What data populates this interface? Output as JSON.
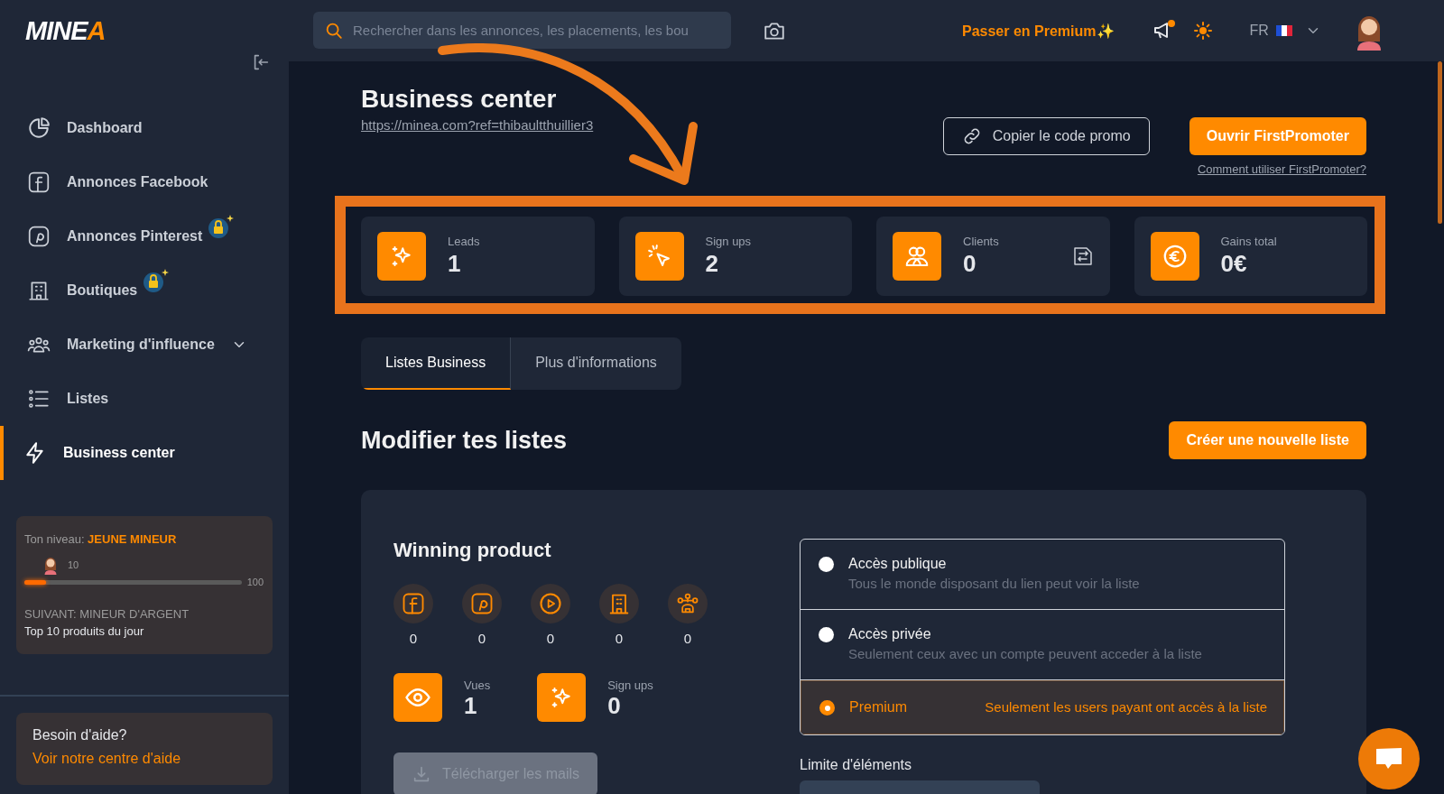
{
  "header": {
    "logo": "MINEA",
    "search": {
      "placeholder": "Rechercher dans les annonces, les placements, les bou"
    },
    "premium_link": "Passer en Premium✨",
    "announcements": {
      "unread": true
    },
    "language": "FR"
  },
  "sidebar": {
    "items": [
      {
        "label": "Dashboard",
        "selected": false,
        "locked": false,
        "expandable": false
      },
      {
        "label": "Annonces Facebook",
        "selected": false,
        "locked": false,
        "expandable": false
      },
      {
        "label": "Annonces Pinterest",
        "selected": false,
        "locked": true,
        "expandable": false
      },
      {
        "label": "Boutiques",
        "selected": false,
        "locked": true,
        "expandable": false
      },
      {
        "label": "Marketing d'influence",
        "selected": false,
        "locked": false,
        "expandable": true
      },
      {
        "label": "Listes",
        "selected": false,
        "locked": false,
        "expandable": false
      },
      {
        "label": "Business center",
        "selected": true,
        "locked": false,
        "expandable": false
      }
    ],
    "level_card": {
      "label": "Ton niveau:",
      "level_name": "JEUNE MINEUR",
      "points": "10",
      "max": "100",
      "level": 0.1,
      "next": "SUIVANT: MINEUR D'ARGENT",
      "reward": "Top 10 produits du jour"
    },
    "help": {
      "title": "Besoin d'aide?",
      "link": "Voir notre centre d'aide"
    }
  },
  "page": {
    "title": "Business center",
    "referral_link": "https://minea.com?ref=thibaultthuillier3",
    "copy_button": "Copier le code promo",
    "open_button": "Ouvrir FirstPromoter",
    "help_link": "Comment utiliser FirstPromoter?"
  },
  "stats": [
    {
      "label": "Leads",
      "value": "1",
      "switchable": false
    },
    {
      "label": "Sign ups",
      "value": "2",
      "switchable": false
    },
    {
      "label": "Clients",
      "value": "0",
      "switchable": true
    },
    {
      "label": "Gains total",
      "value": "0€",
      "switchable": false
    }
  ],
  "tabs": [
    {
      "label": "Listes Business",
      "selected": true
    },
    {
      "label": "Plus d'informations",
      "selected": false
    }
  ],
  "section": {
    "title": "Modifier tes listes",
    "create_button": "Créer une nouvelle liste"
  },
  "list_card": {
    "name": "Winning product",
    "source_counts": [
      "0",
      "0",
      "0",
      "0",
      "0"
    ],
    "metrics": [
      {
        "label": "Vues",
        "value": "1"
      },
      {
        "label": "Sign ups",
        "value": "0"
      }
    ],
    "download_button": {
      "label": "Télécharger les mails",
      "disabled": true
    },
    "access_options": [
      {
        "title": "Accès publique",
        "description": "Tous le monde disposant du lien peut voir la liste",
        "selected": false
      },
      {
        "title": "Accès privée",
        "description": "Seulement ceux avec un compte peuvent acceder à la liste",
        "selected": false
      },
      {
        "title": "Premium",
        "description": "Seulement les users payant ont accès à la liste",
        "selected": true
      }
    ],
    "limit_label": "Limite d'éléments"
  }
}
